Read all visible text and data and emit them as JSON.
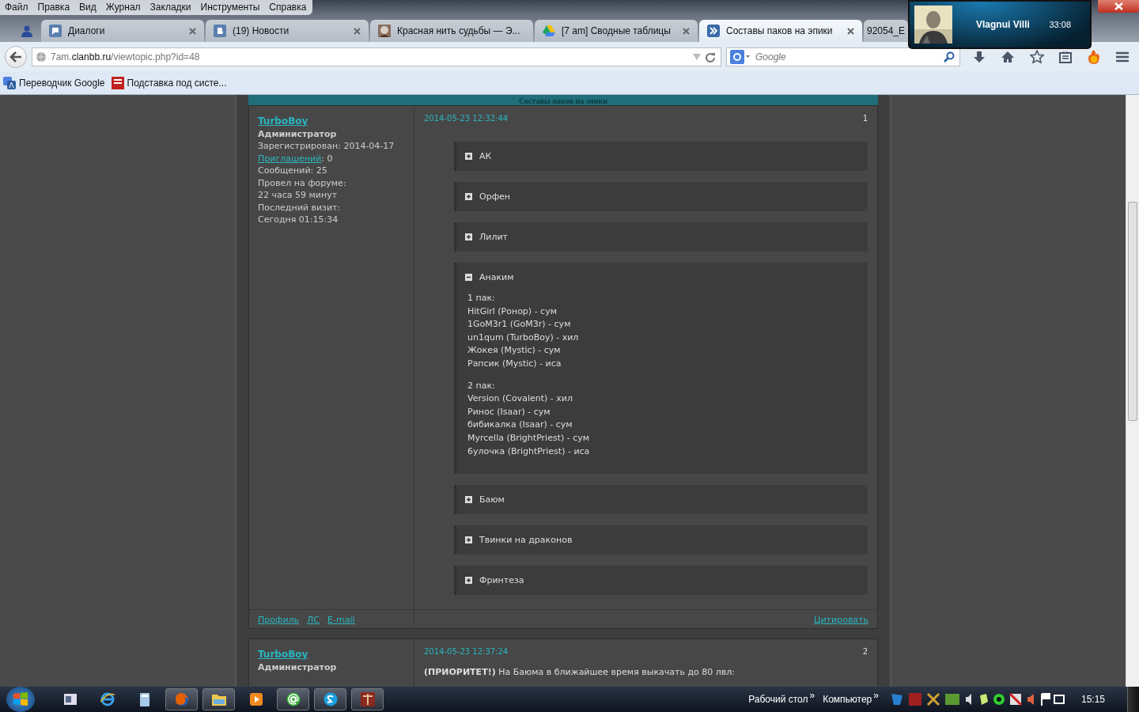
{
  "menu": [
    "Файл",
    "Правка",
    "Вид",
    "Журнал",
    "Закладки",
    "Инструменты",
    "Справка"
  ],
  "tabs": [
    {
      "kind": "pinned",
      "selected": false
    },
    {
      "kind": "chat",
      "title": "Диалоги",
      "selected": false
    },
    {
      "kind": "vk",
      "title": "(19) Новости",
      "selected": false
    },
    {
      "kind": "avatar",
      "title": "Красная нить судьбы — Э...",
      "selected": false
    },
    {
      "kind": "drive",
      "title": "[7 am] Сводные таблицы",
      "selected": false
    },
    {
      "kind": "forum",
      "title": "Составы паков на эпики",
      "selected": true
    },
    {
      "kind": "plain",
      "title": "92054_E",
      "selected": false
    }
  ],
  "address": {
    "host_prefix": "7am.",
    "host": "clanbb.ru",
    "path": "/viewtopic.php?id=48"
  },
  "search": {
    "placeholder": "Google"
  },
  "bookmarks": [
    {
      "kind": "translate",
      "title": "Переводчик Google"
    },
    {
      "kind": "pet",
      "title": "Подставка под систе..."
    }
  ],
  "notification": {
    "name": "Vlagnui Villi",
    "time": "33:08"
  },
  "topic_title": "Составы паков на эпики",
  "posts": [
    {
      "author": "TurboBoy",
      "role": "Администратор",
      "info": [
        "Зарегистрирован: 2014-04-17"
      ],
      "invites_label": "Приглашений",
      "invites_value": ": 0",
      "info_after": [
        "Сообщений: 25",
        "Провел на форуме:",
        "22 часа 59 минут",
        "Последний визит:",
        "Сегодня 01:15:34"
      ],
      "date": "2014-05-23 12:32:44",
      "number": "1",
      "spoilers": [
        {
          "title": "АК",
          "expanded": false
        },
        {
          "title": "Орфен",
          "expanded": false
        },
        {
          "title": "Лилит",
          "expanded": false
        },
        {
          "title": "Анаким",
          "expanded": true,
          "groups": [
            [
              "1 пак:",
              "HitGirl (Ронор) - сум",
              "1GoM3r1 (GoM3r) - сум",
              "un1qum (TurboBoy) - хил",
              "Жокея (Mystic) - сум",
              "Рапсик (Mystic) - иса"
            ],
            [
              "2 пак:",
              "Version (Covalent) - хил",
              "Ринос (Isaar) - сум",
              "бибикалка (Isaar) - сум",
              "Myrcella (BrightPriest) - сум",
              "6улочка (BrightPriest) - иса"
            ]
          ]
        },
        {
          "title": "Баюм",
          "expanded": false
        },
        {
          "title": "Твинки на драконов",
          "expanded": false
        },
        {
          "title": "Фринтеза",
          "expanded": false
        }
      ],
      "links": [
        "Профиль",
        "ЛС",
        "E-mail"
      ],
      "quote": "Цитировать"
    },
    {
      "author": "TurboBoy",
      "role": "Администратор",
      "date": "2014-05-23 12:37:24",
      "number": "2",
      "text": "**(ПРИОРИТЕТ!)** На Баюма в ближайшее время выкачать до 80 лвл:"
    }
  ],
  "taskbar": {
    "toolbars": [
      "Рабочий стол",
      "Компьютер"
    ],
    "chevron": "»",
    "clock": "15:15",
    "apps": [
      {
        "kind": "window",
        "selected": false
      },
      {
        "kind": "ie",
        "selected": false
      },
      {
        "kind": "calc",
        "selected": false
      },
      {
        "kind": "firefox",
        "selected": true
      },
      {
        "kind": "folder",
        "selected": true
      },
      {
        "kind": "player",
        "selected": false
      },
      {
        "kind": "mail",
        "selected": true
      },
      {
        "kind": "skype",
        "selected": true
      },
      {
        "kind": "book",
        "selected": true
      }
    ]
  }
}
